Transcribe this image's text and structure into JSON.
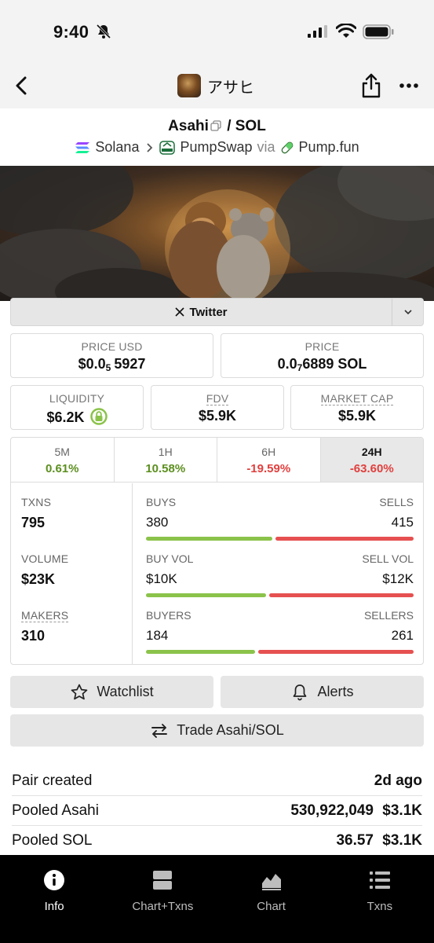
{
  "status": {
    "time": "9:40"
  },
  "nav": {
    "title": "アサヒ"
  },
  "pair": {
    "base": "Asahi",
    "quote": "/ SOL",
    "chain": "Solana",
    "dex": "PumpSwap",
    "via": "via",
    "launchpad": "Pump.fun"
  },
  "twitter": {
    "label": "Twitter"
  },
  "price_usd": {
    "label": "PRICE USD",
    "prefix": "$0.0",
    "sub": "5",
    "suffix": "5927"
  },
  "price": {
    "label": "PRICE",
    "prefix": "0.0",
    "sub": "7",
    "suffix": "6889 SOL"
  },
  "liquidity": {
    "label": "LIQUIDITY",
    "value": "$6.2K"
  },
  "fdv": {
    "label": "FDV",
    "value": "$5.9K"
  },
  "market_cap": {
    "label": "MARKET CAP",
    "value": "$5.9K"
  },
  "tabs": [
    {
      "label": "5M",
      "value": "0.61%"
    },
    {
      "label": "1H",
      "value": "10.58%"
    },
    {
      "label": "6H",
      "value": "-19.59%"
    },
    {
      "label": "24H",
      "value": "-63.60%"
    }
  ],
  "active_tab": "24H",
  "stats": {
    "txns": {
      "label": "TXNS",
      "value": "795"
    },
    "volume": {
      "label": "VOLUME",
      "value": "$23K"
    },
    "makers": {
      "label": "MAKERS",
      "value": "310"
    },
    "buys": {
      "left_label": "BUYS",
      "right_label": "SELLS",
      "left": "380",
      "right": "415",
      "left_fraction": 0.478
    },
    "buy_vol": {
      "left_label": "BUY VOL",
      "right_label": "SELL VOL",
      "left": "$10K",
      "right": "$12K",
      "left_fraction": 0.455
    },
    "buyers": {
      "left_label": "BUYERS",
      "right_label": "SELLERS",
      "left": "184",
      "right": "261",
      "left_fraction": 0.413
    }
  },
  "buttons": {
    "watchlist": "Watchlist",
    "alerts": "Alerts",
    "trade": "Trade Asahi/SOL"
  },
  "info": {
    "pair_created": {
      "label": "Pair created",
      "value": "2d ago"
    },
    "pooled_base": {
      "label": "Pooled Asahi",
      "amount": "530,922,049",
      "usd": "$3.1K"
    },
    "pooled_quote": {
      "label": "Pooled SOL",
      "amount": "36.57",
      "usd": "$3.1K"
    }
  },
  "bottom_nav": [
    {
      "label": "Info",
      "icon": "info-icon"
    },
    {
      "label": "Chart+Txns",
      "icon": "chart-txns-icon"
    },
    {
      "label": "Chart",
      "icon": "chart-icon"
    },
    {
      "label": "Txns",
      "icon": "list-icon"
    }
  ],
  "colors": {
    "positive": "#5c8f1f",
    "negative": "#e0403e",
    "buy_bar": "#8bc34a",
    "sell_bar": "#e65050"
  }
}
